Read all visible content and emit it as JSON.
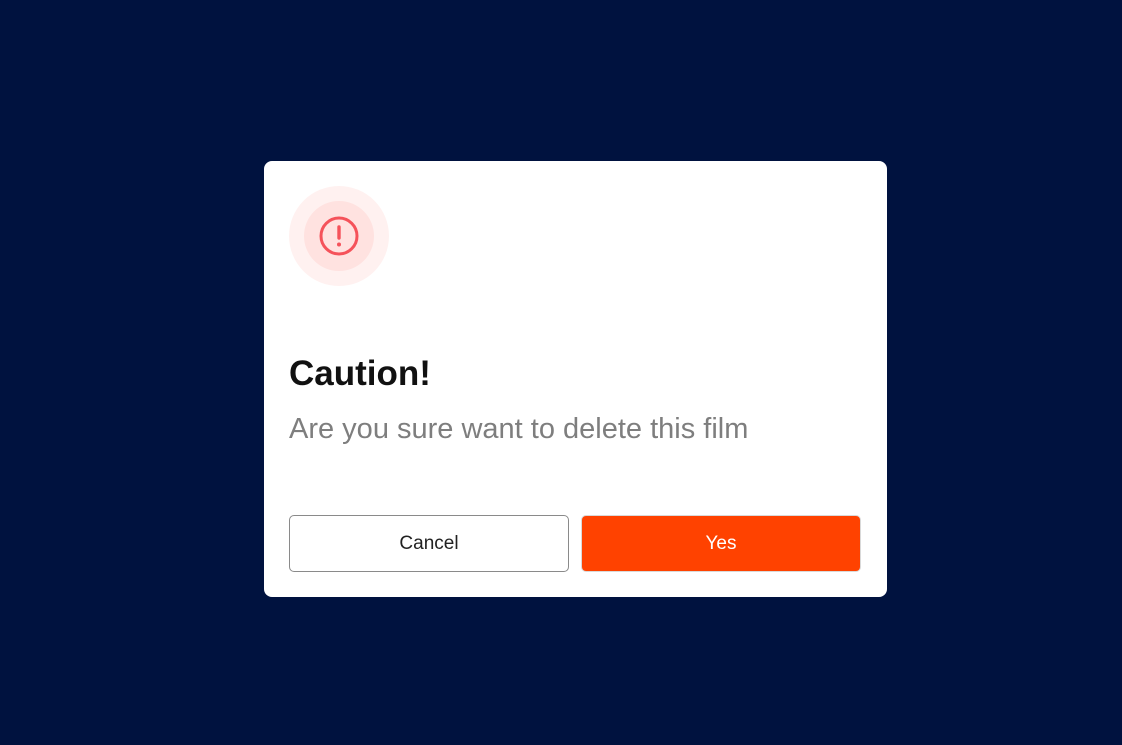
{
  "dialog": {
    "title": "Caution!",
    "message": "Are you sure want to delete this film",
    "icon": "alert-circle-icon",
    "buttons": {
      "cancel_label": "Cancel",
      "confirm_label": "Yes"
    }
  },
  "colors": {
    "backdrop": "#00123f",
    "dialog_background": "#ffffff",
    "confirm_button": "#ff4200",
    "icon_stroke": "#f5525a",
    "icon_halo_outer": "#fff1f0",
    "icon_halo_inner": "#ffe2e0",
    "message_text": "#7e7e7e"
  }
}
